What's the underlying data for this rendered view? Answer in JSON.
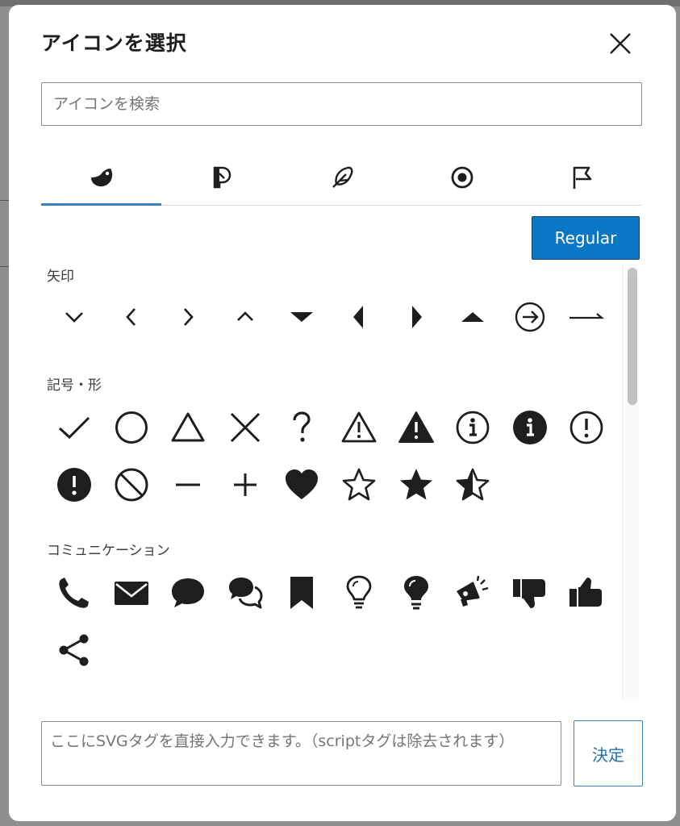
{
  "dialog": {
    "title": "アイコンを選択",
    "search_placeholder": "アイコンを検索",
    "style_button": "Regular",
    "svg_placeholder": "ここにSVGタグを直接入力できます。（scriptタグは除去されます）",
    "submit_label": "決定"
  },
  "tabs": [
    {
      "icon": "moon-icon",
      "active": true
    },
    {
      "icon": "brand-icon",
      "active": false
    },
    {
      "icon": "feather-icon",
      "active": false
    },
    {
      "icon": "target-icon",
      "active": false
    },
    {
      "icon": "flag-icon",
      "active": false
    }
  ],
  "categories": [
    {
      "label": "矢印",
      "icons": [
        "chevron-down-icon",
        "chevron-left-icon",
        "chevron-right-icon",
        "chevron-up-icon",
        "caret-down-icon",
        "caret-left-icon",
        "caret-right-icon",
        "caret-up-icon",
        "arrow-circle-right-icon",
        "arrow-long-right-icon"
      ]
    },
    {
      "label": "記号・形",
      "icons": [
        "check-icon",
        "circle-icon",
        "triangle-icon",
        "x-icon",
        "question-icon",
        "warning-outline-icon",
        "warning-filled-icon",
        "info-outline-icon",
        "info-filled-icon",
        "exclamation-outline-icon",
        "exclamation-filled-icon",
        "prohibited-icon",
        "minus-icon",
        "plus-icon",
        "heart-icon",
        "star-outline-icon",
        "star-filled-icon",
        "star-half-icon"
      ]
    },
    {
      "label": "コミュニケーション",
      "icons": [
        "phone-icon",
        "envelope-icon",
        "chat-bubble-icon",
        "chats-icon",
        "bookmark-icon",
        "lightbulb-outline-icon",
        "lightbulb-filled-icon",
        "megaphone-icon",
        "thumbs-down-icon",
        "thumbs-up-icon",
        "share-icon"
      ]
    }
  ],
  "colors": {
    "accent": "#0a78c4",
    "tab_indicator": "#3582c4",
    "icon": "#1e1e1e"
  }
}
